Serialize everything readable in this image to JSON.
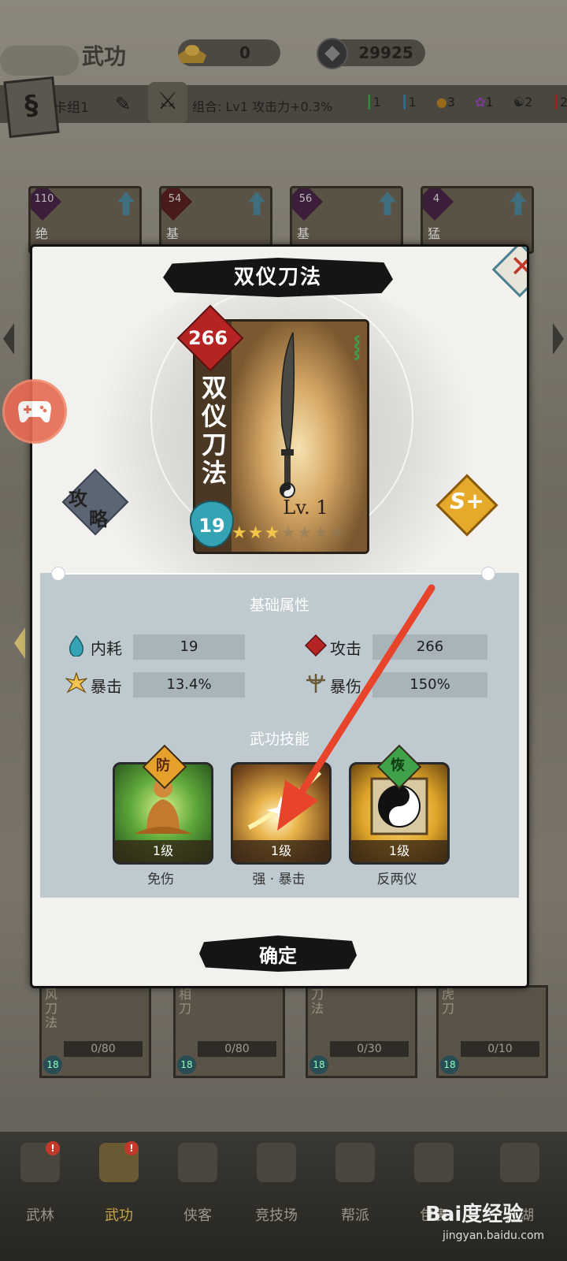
{
  "header": {
    "title": "武功",
    "ingot_value": "0",
    "coin_value": "29925"
  },
  "deck": {
    "name": "卡组1",
    "combo_text": "组合: Lv1 攻击力+0.3%",
    "tags": [
      {
        "icon": "green-sword-icon",
        "count": "1",
        "color": "#2f8a3c"
      },
      {
        "icon": "blue-sword-icon",
        "count": "1",
        "color": "#2f6f9a"
      },
      {
        "icon": "shield-icon",
        "count": "3",
        "color": "#9a6a1c"
      },
      {
        "icon": "purple-flower-icon",
        "count": "1",
        "color": "#7b3b9a"
      },
      {
        "icon": "yinyang-icon",
        "count": "2",
        "color": "#222222"
      },
      {
        "icon": "red-blade-icon",
        "count": "2",
        "color": "#a01f1f"
      }
    ]
  },
  "top_cards": [
    {
      "level": "110",
      "name": "绝"
    },
    {
      "level": "54",
      "name": "基"
    },
    {
      "level": "56",
      "name": "基"
    },
    {
      "level": "4",
      "name": "猛"
    }
  ],
  "bottom_cards": [
    {
      "name": "风刀法",
      "progress": "0/80",
      "cost": "18"
    },
    {
      "name": "相刀",
      "progress": "0/80",
      "cost": "18"
    },
    {
      "name": "刀法",
      "progress": "0/30",
      "cost": "18"
    },
    {
      "name": "虎刀",
      "progress": "0/10",
      "cost": "18"
    }
  ],
  "modal": {
    "title": "双仪刀法",
    "card": {
      "name": "双仪刀法",
      "attack": "266",
      "cost": "19",
      "level": "Lv. 1",
      "stars_filled": 3,
      "stars_total": 7
    },
    "guide_label_1": "攻",
    "guide_label_2": "略",
    "grade": "S+",
    "basic_title": "基础属性",
    "stats": {
      "neihao_label": "内耗",
      "neihao_value": "19",
      "attack_label": "攻击",
      "attack_value": "266",
      "crit_label": "暴击",
      "crit_value": "13.4%",
      "critdmg_label": "暴伤",
      "critdmg_value": "150%"
    },
    "skills_title": "武功技能",
    "skills": [
      {
        "name": "免伤",
        "level": "1级",
        "badge": "防",
        "badge_color": "#e6a12c"
      },
      {
        "name": "强 · 暴击",
        "level": "1级",
        "badge": "",
        "badge_color": ""
      },
      {
        "name": "反两仪",
        "level": "1级",
        "badge": "恢",
        "badge_color": "#3fa14a"
      }
    ],
    "confirm_label": "确定"
  },
  "nav": [
    {
      "label": "武林",
      "badge": "!"
    },
    {
      "label": "武功",
      "badge": "!"
    },
    {
      "label": "侠客",
      "badge": ""
    },
    {
      "label": "竞技场",
      "badge": ""
    },
    {
      "label": "帮派",
      "badge": ""
    },
    {
      "label": "包裹",
      "badge": ""
    },
    {
      "label": "江湖",
      "badge": ""
    }
  ],
  "watermark": {
    "brand": "Bai度经验",
    "sub": "jingyan.baidu.com"
  }
}
